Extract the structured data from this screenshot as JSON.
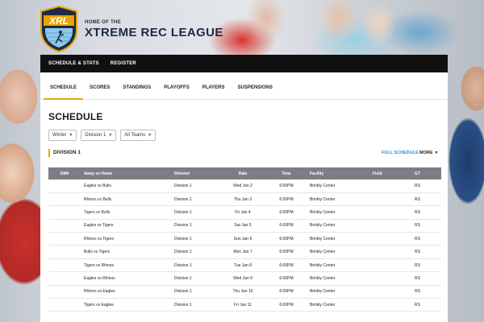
{
  "brand": {
    "logo_text": "XRL",
    "home_of": "HOME OF THE",
    "league_name": "XTREME REC LEAGUE",
    "colors": {
      "navy": "#1b2b45",
      "gold": "#e8a400",
      "sky": "#8ec8ea"
    }
  },
  "main_nav": [
    "SCHEDULE & STATS",
    "REGISTER"
  ],
  "sub_nav": {
    "tabs": [
      "SCHEDULE",
      "SCORES",
      "STANDINGS",
      "PLAYOFFS",
      "PLAYERS",
      "SUSPENSIONS"
    ],
    "active": "SCHEDULE"
  },
  "page_title": "SCHEDULE",
  "filters": {
    "season": "Winter",
    "division": "Division 1",
    "team": "All Teams"
  },
  "division_header": "DIVISION 1",
  "links": {
    "full_schedule": "FULL SCHEDULE",
    "more": "MORE"
  },
  "table": {
    "headers": [
      "GM#",
      "Away vs Home",
      "Division",
      "Date",
      "Time",
      "Facility",
      "Field",
      "GT"
    ],
    "rows": [
      [
        "",
        "Eagles  vs  Bulls",
        "Division 1",
        "Wed Jan 2",
        "6:00PM",
        "Brinkly Center",
        "",
        "RS"
      ],
      [
        "",
        "Rhinos  vs  Bulls",
        "Division 1",
        "Thu Jan 3",
        "6:00PM",
        "Brinkly Center",
        "",
        "RS"
      ],
      [
        "",
        "Tigers  vs  Bulls",
        "Division 1",
        "Fri Jan 4",
        "6:00PM",
        "Brinkly Center",
        "",
        "RS"
      ],
      [
        "",
        "Eagles  vs  Tigers",
        "Division 1",
        "Sat Jan 5",
        "6:00PM",
        "Brinkly Center",
        "",
        "RS"
      ],
      [
        "",
        "Rhinos  vs  Tigers",
        "Division 1",
        "Sun Jan 6",
        "6:00PM",
        "Brinkly Center",
        "",
        "RS"
      ],
      [
        "",
        "Bulls  vs  Tigers",
        "Division 1",
        "Mon Jan 7",
        "6:00PM",
        "Brinkly Center",
        "",
        "RS"
      ],
      [
        "",
        "Tigers  vs  Rhinos",
        "Division 1",
        "Tue Jan 8",
        "6:00PM",
        "Brinkly Center",
        "",
        "RS"
      ],
      [
        "",
        "Eagles  vs  Rhinos",
        "Division 1",
        "Wed Jan 9",
        "6:00PM",
        "Brinkly Center",
        "",
        "RS"
      ],
      [
        "",
        "Rhinos  vs  Eagles",
        "Division 1",
        "Thu Jan 10",
        "6:00PM",
        "Brinkly Center",
        "",
        "RS"
      ],
      [
        "",
        "Tigers  vs  Eagles",
        "Division 1",
        "Fri Jan 11",
        "6:00PM",
        "Brinkly Center",
        "",
        "RS"
      ]
    ]
  }
}
